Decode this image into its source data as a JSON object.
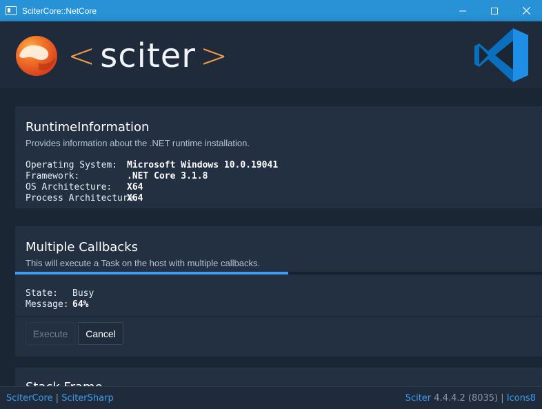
{
  "window": {
    "title": "SciterCore::NetCore"
  },
  "header": {
    "logo_text": "sciter",
    "bracket_left": "<",
    "bracket_right": ">"
  },
  "runtime": {
    "title": "RuntimeInformation",
    "description": "Provides information about the .NET runtime installation.",
    "rows": [
      {
        "key": "Operating System:",
        "value": "Microsoft Windows 10.0.19041"
      },
      {
        "key": "Framework:",
        "value": ".NET Core 3.1.8"
      },
      {
        "key": "OS Architecture:",
        "value": "X64"
      },
      {
        "key": "Process Architecture:",
        "value": "X64"
      }
    ]
  },
  "callbacks": {
    "title": "Multiple Callbacks",
    "description": "This will execute a Task on the host with multiple callbacks.",
    "progress_percent": 64,
    "state_key": "State:",
    "state_value": "Busy",
    "message_key": "Message:",
    "message_value": "64%",
    "execute_label": "Execute",
    "cancel_label": "Cancel"
  },
  "next_card": {
    "title": "Stack Frame"
  },
  "status": {
    "left_link1": "SciterCore",
    "left_sep": " | ",
    "left_link2": "SciterSharp",
    "right_link1": "Sciter",
    "right_version": " 4.4.4.2 (8035) ",
    "right_sep": "| ",
    "right_link2": "Icons8"
  },
  "colors": {
    "accent": "#2792d6",
    "link": "#3b9cf0",
    "progress": "#3f9cf0",
    "brand_orange": "#f19b4a"
  }
}
